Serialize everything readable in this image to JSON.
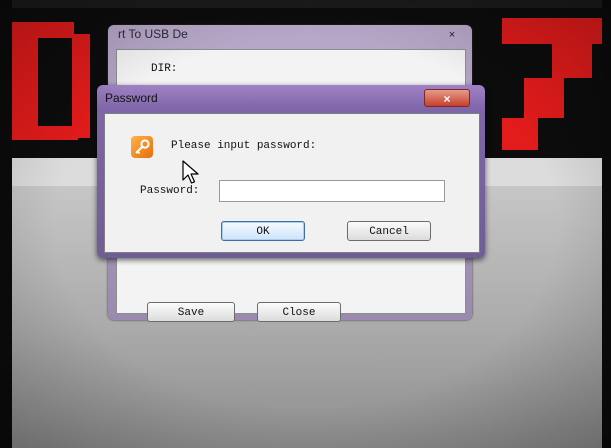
{
  "background_window": {
    "title": "rt To USB De",
    "dir_label": "DIR:",
    "save_label": "Save",
    "close_label": "Close",
    "close_glyph": "×"
  },
  "password_dialog": {
    "title": "Password",
    "close_glyph": "×",
    "prompt": "Please input password:",
    "password_label": "Password:",
    "password_value": "",
    "ok_label": "OK",
    "cancel_label": "Cancel"
  },
  "colors": {
    "led_red": "#e21b1b",
    "dialog_frame": "#7f66a8",
    "close_button": "#c6402c",
    "key_icon": "#e36f0d"
  },
  "icons": [
    "key-icon",
    "close-icon",
    "mouse-pointer-icon"
  ]
}
